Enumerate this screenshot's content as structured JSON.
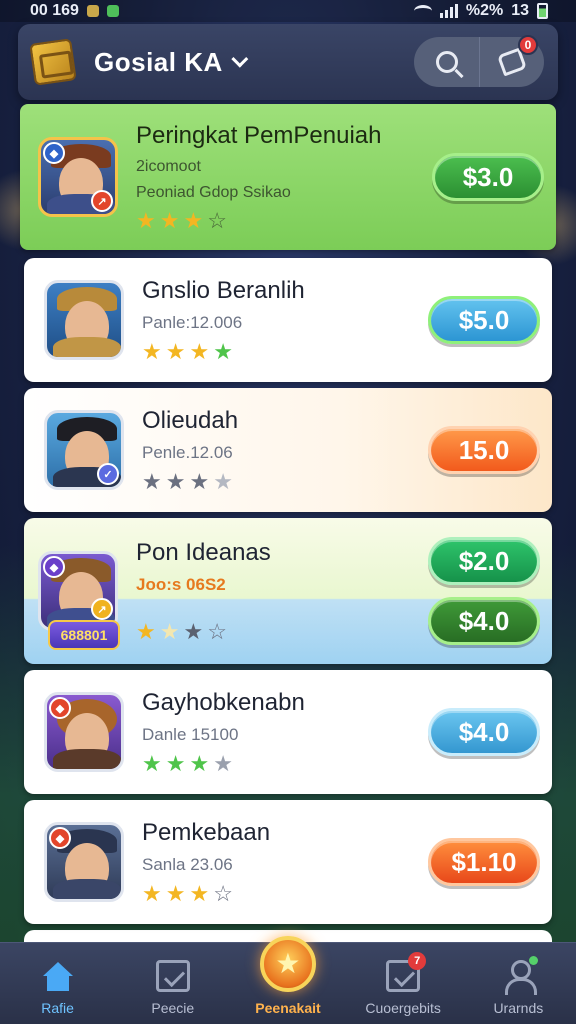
{
  "status_bar": {
    "time": "00 169",
    "signal_text": "%2%",
    "battery_text": "13"
  },
  "header": {
    "title": "Gosial KA",
    "notification_count": "0"
  },
  "list": {
    "items": [
      {
        "name": "Peringkat PemPenuiah",
        "line1": "2icomoot",
        "line2": "Peoniad Gdop Ssikao",
        "rating": 3,
        "price": "$3.0"
      },
      {
        "name": "Gnslio Beranlih",
        "line1": "Panle:12.006",
        "rating": 4,
        "price": "$5.0"
      },
      {
        "name": "Olieudah",
        "line1": "Penle.12.06",
        "rating": 3,
        "price": "15.0"
      },
      {
        "name": "Pon Ideanas",
        "line1": "Joo:s 06S2",
        "tag": "688801",
        "rating": 2,
        "price_top": "$2.0",
        "price_bottom": "$4.0"
      },
      {
        "name": "Gayhobkenabn",
        "line1": "Danle 15100",
        "rating": 3,
        "price": "$4.0"
      },
      {
        "name": "Pemkebaan",
        "line1": "Sanla 23.06",
        "rating": 3,
        "price": "$1.10"
      }
    ]
  },
  "bottom_nav": {
    "items": [
      {
        "label": "Rafie"
      },
      {
        "label": "Peecie"
      },
      {
        "label": "Peenakait"
      },
      {
        "label": "Cuoergebits",
        "badge": "7"
      },
      {
        "label": "Urarnds"
      }
    ]
  },
  "icons": [
    "logo-chest-icon",
    "search-icon",
    "refresh-icon",
    "home-icon",
    "box-check-icon",
    "star-emblem-icon",
    "user-icon"
  ],
  "colors": {
    "accent_green": "#7ccd57",
    "accent_blue": "#4aa9f5",
    "accent_orange": "#f25a1c",
    "header_bg": "#2b3452"
  }
}
